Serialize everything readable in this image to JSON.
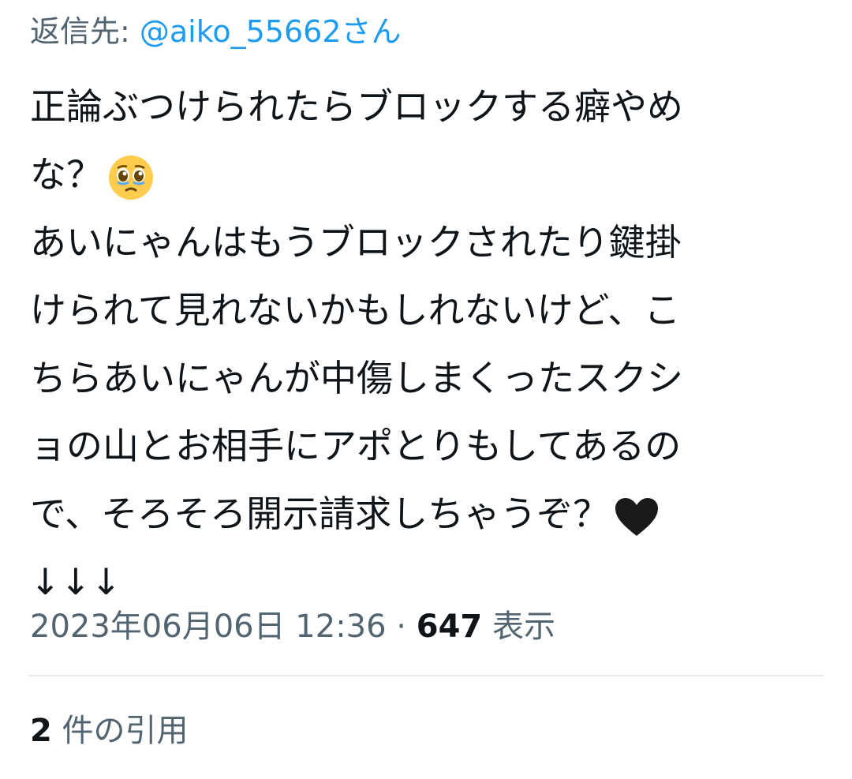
{
  "reply": {
    "prefix": "返信先: ",
    "handle": "@aiko_55662さん"
  },
  "tweet": {
    "lines": [
      "正論ぶつけられたらブロックする癖やめ",
      "な？",
      "あいにゃんはもうブロックされたり鍵掛",
      "けられて見れないかもしれないけど、こ",
      "ちらあいにゃんが中傷しまくったスクシ",
      "ョの山とお相手にアポとりもしてあるの",
      "で、そろそろ開示請求しちゃうぞ？",
      "↓↓↓"
    ],
    "emojis": {
      "pleading": "pleading-face-emoji",
      "heart": "black-heart-emoji"
    }
  },
  "meta": {
    "timestamp": "2023年06月06日 12:36",
    "separator": " · ",
    "views_count": "647",
    "views_label": " 表示"
  },
  "engagement": {
    "quote_count": "2",
    "quote_label": " 件の引用"
  },
  "colors": {
    "link": "#1d9bf0",
    "secondary_text": "#536471",
    "primary_text": "#0f1419",
    "divider": "#e6ecf0"
  }
}
